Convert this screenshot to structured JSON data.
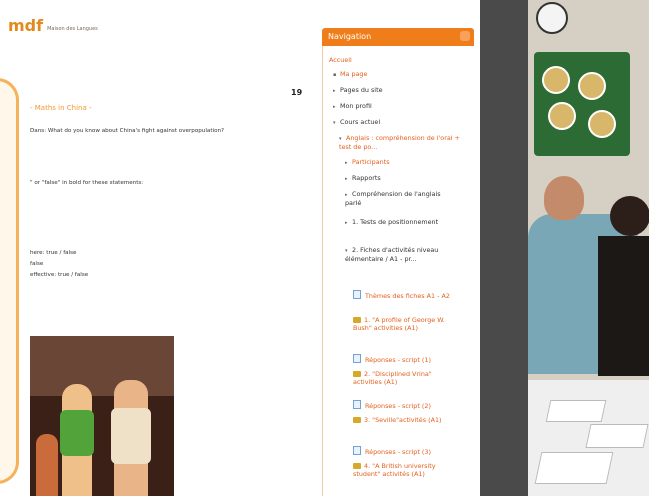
{
  "document": {
    "logo_text": "mdf",
    "logo_sub": "Maison des Langues",
    "page_number": "19",
    "title": "- Maths in China -",
    "lines": [
      "Dans: What do you know about China's fight against overpopulation?",
      "\" or \"false\" in bold for these statements:",
      "here: true / false",
      "false",
      "effective: true / false"
    ]
  },
  "navigation": {
    "title": "Navigation",
    "items": [
      {
        "label": "Accueil",
        "link": true
      },
      {
        "label": "Ma page",
        "link": true
      },
      {
        "label": "Pages du site",
        "link": false
      },
      {
        "label": "Mon profil",
        "link": false
      },
      {
        "label": "Cours actuel",
        "link": false
      },
      {
        "label": "Anglais : compréhension de l'oral + test de po...",
        "link": true
      },
      {
        "label": "Participants",
        "link": true
      },
      {
        "label": "Rapports",
        "link": false
      },
      {
        "label": "Compréhension de l'anglais parlé",
        "link": false
      },
      {
        "label": "1. Tests de positionnement",
        "link": false
      },
      {
        "label": "2. Fiches d'activités niveau élémentaire / A1 - pr...",
        "link": false
      },
      {
        "label": "Thèmes des fiches A1 - A2",
        "link": true
      },
      {
        "label": "1. \"A profile of George W. Bush\" activities (A1)",
        "link": true
      },
      {
        "label": "Réponses - script (1)",
        "link": true
      },
      {
        "label": "2. \"Disciplined Vrina\" activities (A1)",
        "link": true
      },
      {
        "label": "Réponses - script (2)",
        "link": true
      },
      {
        "label": "3. \"Seville\"activités (A1)",
        "link": true
      },
      {
        "label": "Réponses - script (3)",
        "link": true
      },
      {
        "label": "4. \"A British university student\" activités (A1)",
        "link": true
      }
    ]
  },
  "colors": {
    "nav_header": "#ef7d1a",
    "link": "#e4601e",
    "accent": "#f29a2c"
  }
}
